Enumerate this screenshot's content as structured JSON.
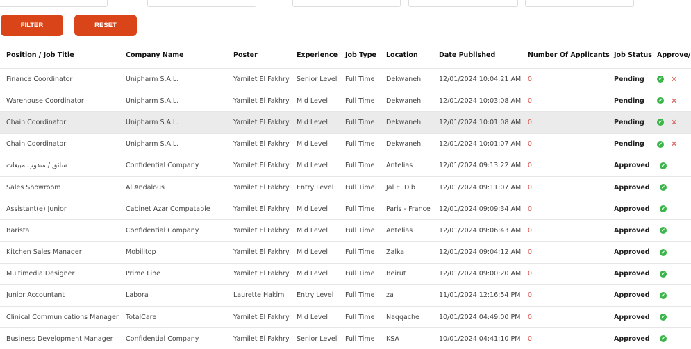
{
  "filters": {
    "filter_label": "FILTER",
    "reset_label": "RESET"
  },
  "columns": [
    "Position / Job Title",
    "Company Name",
    "Poster",
    "Experience",
    "Job Type",
    "Location",
    "Date Published",
    "Number Of Applicants",
    "Job Status",
    "Approve/Reject"
  ],
  "rows": [
    [
      "Finance Coordinator",
      "Unipharm S.A.L.",
      "Yamilet El Fakhry",
      "Senior Level",
      "Full Time",
      "Dekwaneh",
      "12/01/2024 10:04:21 AM",
      "0",
      "Pending"
    ],
    [
      "Warehouse Coordinator",
      "Unipharm S.A.L.",
      "Yamilet El Fakhry",
      "Mid Level",
      "Full Time",
      "Dekwaneh",
      "12/01/2024 10:03:08 AM",
      "0",
      "Pending"
    ],
    [
      "Chain Coordinator",
      "Unipharm S.A.L.",
      "Yamilet El Fakhry",
      "Mid Level",
      "Full Time",
      "Dekwaneh",
      "12/01/2024 10:01:08 AM",
      "0",
      "Pending"
    ],
    [
      "Chain Coordinator",
      "Unipharm S.A.L.",
      "Yamilet El Fakhry",
      "Mid Level",
      "Full Time",
      "Dekwaneh",
      "12/01/2024 10:01:07 AM",
      "0",
      "Pending"
    ],
    [
      "سائق / مندوب مبيعات",
      "Confidential Company",
      "Yamilet El Fakhry",
      "Mid Level",
      "Full Time",
      "Antelias",
      "12/01/2024 09:13:22 AM",
      "0",
      "Approved"
    ],
    [
      "Sales Showroom",
      "Al Andalous",
      "Yamilet El Fakhry",
      "Entry Level",
      "Full Time",
      "Jal El Dib",
      "12/01/2024 09:11:07 AM",
      "0",
      "Approved"
    ],
    [
      "Assistant(e) Junior",
      "Cabinet Azar Compatable",
      "Yamilet El Fakhry",
      "Mid Level",
      "Full Time",
      "Paris - France",
      "12/01/2024 09:09:34 AM",
      "0",
      "Approved"
    ],
    [
      "Barista",
      "Confidential Company",
      "Yamilet El Fakhry",
      "Mid Level",
      "Full Time",
      "Antelias",
      "12/01/2024 09:06:43 AM",
      "0",
      "Approved"
    ],
    [
      "Kitchen Sales Manager",
      "Mobilitop",
      "Yamilet El Fakhry",
      "Mid Level",
      "Full Time",
      "Zalka",
      "12/01/2024 09:04:12 AM",
      "0",
      "Approved"
    ],
    [
      "Multimedia Designer",
      "Prime Line",
      "Yamilet El Fakhry",
      "Mid Level",
      "Full Time",
      "Beirut",
      "12/01/2024 09:00:20 AM",
      "0",
      "Approved"
    ],
    [
      "Junior Accountant",
      "Labora",
      "Laurette Hakim",
      "Entry Level",
      "Full Time",
      "za",
      "11/01/2024 12:16:54 PM",
      "0",
      "Approved"
    ],
    [
      "Clinical Communications Manager",
      "TotalCare",
      "Yamilet El Fakhry",
      "Mid Level",
      "Full Time",
      "Naqqache",
      "10/01/2024 04:49:00 PM",
      "0",
      "Approved"
    ],
    [
      "Business Development Manager",
      "Confidential Company",
      "Yamilet El Fakhry",
      "Senior Level",
      "Full Time",
      "KSA",
      "10/01/2024 04:41:10 PM",
      "0",
      "Approved"
    ]
  ],
  "colors": {
    "accent": "#d94418",
    "approve": "#3cb54a",
    "reject": "#d9534f"
  }
}
